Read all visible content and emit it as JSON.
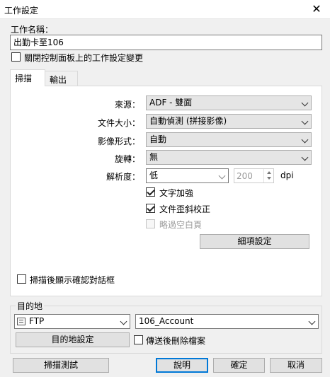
{
  "window": {
    "title": "工作設定",
    "close_glyph": "✕"
  },
  "job_name": {
    "label": "工作名稱：",
    "value": "出勤卡至106"
  },
  "close_panel_checkbox": {
    "label": "關閉控制面板上的工作設定變更",
    "checked": false
  },
  "tabs": [
    {
      "label": "掃描",
      "active": true
    },
    {
      "label": "輸出",
      "active": false
    }
  ],
  "scan": {
    "source": {
      "label": "來源：",
      "value": "ADF - 雙面"
    },
    "doc_size": {
      "label": "文件大小：",
      "value": "自動偵測 (拼接影像)"
    },
    "image_format": {
      "label": "影像形式：",
      "value": "自動"
    },
    "rotation": {
      "label": "旋轉：",
      "value": "無"
    },
    "resolution": {
      "label": "解析度：",
      "value": "低",
      "dpi_value": "200",
      "dpi_unit": "dpi"
    },
    "text_enhance": {
      "label": "文字加強",
      "checked": true
    },
    "deskew": {
      "label": "文件歪斜校正",
      "checked": true
    },
    "skip_blank": {
      "label": "略過空白頁",
      "checked": false,
      "enabled": false
    },
    "details_button": "細項設定",
    "show_confirm_dialog": {
      "label": "掃描後顯示確認對話框",
      "checked": false
    }
  },
  "destination": {
    "group_label": "目的地",
    "type": {
      "value": "FTP",
      "icon": "ftp-icon"
    },
    "target": {
      "value": "106_Account"
    },
    "settings_button": "目的地設定",
    "delete_after_send": {
      "label": "傳送後刪除檔案",
      "checked": false
    }
  },
  "footer": {
    "scan_test": "掃描測試",
    "help": "說明",
    "ok": "確定",
    "cancel": "取消"
  },
  "colors": {
    "accent_border": "#0078d7",
    "dialog_bg": "#f0f0f0",
    "panel_bg": "#ffffff"
  }
}
